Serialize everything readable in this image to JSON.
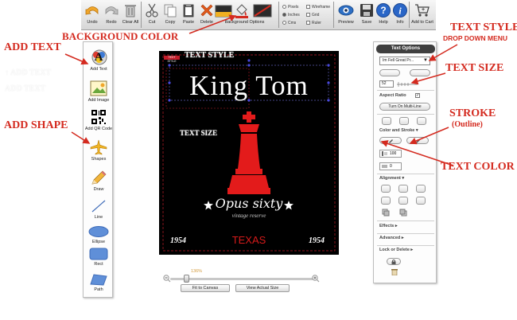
{
  "toolbar": {
    "undo": "Undo",
    "redo": "Redo",
    "clear_all": "Clear All",
    "cut": "Cut",
    "copy": "Copy",
    "paste": "Paste",
    "delete": "Delete",
    "background_options": "Background Options",
    "units": [
      "Pixels",
      "Inches",
      "Cms"
    ],
    "selected_unit": "Inches",
    "toggles": [
      "Wireframe",
      "Grid",
      "Ruler"
    ],
    "preview": "Preview",
    "save": "Save",
    "help": "Help",
    "info": "Info",
    "add_to_cart": "Add to Cart"
  },
  "tools": [
    {
      "label": "Add Text",
      "icon": "add-text-icon"
    },
    {
      "label": "Add Image",
      "icon": "add-image-icon"
    },
    {
      "label": "Add QR Code",
      "icon": "qr-code-icon"
    },
    {
      "label": "Shapes",
      "icon": "airplane-icon"
    },
    {
      "label": "Draw",
      "icon": "pencil-icon"
    },
    {
      "label": "Line",
      "icon": "line-icon"
    },
    {
      "label": "Ellipse",
      "icon": "ellipse-icon"
    },
    {
      "label": "Rect",
      "icon": "rect-icon"
    },
    {
      "label": "Path",
      "icon": "path-icon"
    }
  ],
  "design": {
    "title": "King Tom",
    "subtitle": "Opus sixty",
    "tagline": "vintage reserve",
    "year_left": "1954",
    "year_right": "1954",
    "region": "TEXAS",
    "selected_tag": "TEXT STYLE",
    "colors": {
      "background": "#000000",
      "accent": "#e31b1b",
      "text": "#ffffff"
    }
  },
  "zoom": {
    "percent": "136%",
    "fit_button": "Fit to Canvas",
    "actual_button": "View Actual Size"
  },
  "text_options": {
    "header": "Text Options",
    "font": "Im Fell Great Pr...",
    "size": "52",
    "aspect_ratio_label": "Aspect Ratio",
    "multiline_button": "Turn On Multi-Line",
    "color_stroke_label": "Color and Stroke",
    "stroke_width": "100",
    "stroke_value": "0",
    "alignment_label": "Alignment",
    "effects_label": "Effects",
    "advanced_label": "Advanced",
    "lock_label": "Lock or Delete"
  },
  "annotations": {
    "background_color": "BACKGROUND COLOR",
    "add_text": "ADD TEXT",
    "add_shape": "ADD SHAPE",
    "text_style": "TEXT STYLE",
    "text_style_sub": "DROP DOWN MENU",
    "text_size": "TEXT SIZE",
    "stroke": "STROKE",
    "stroke_sub": "(Outline)",
    "text_color": "TEXT COLOR"
  }
}
